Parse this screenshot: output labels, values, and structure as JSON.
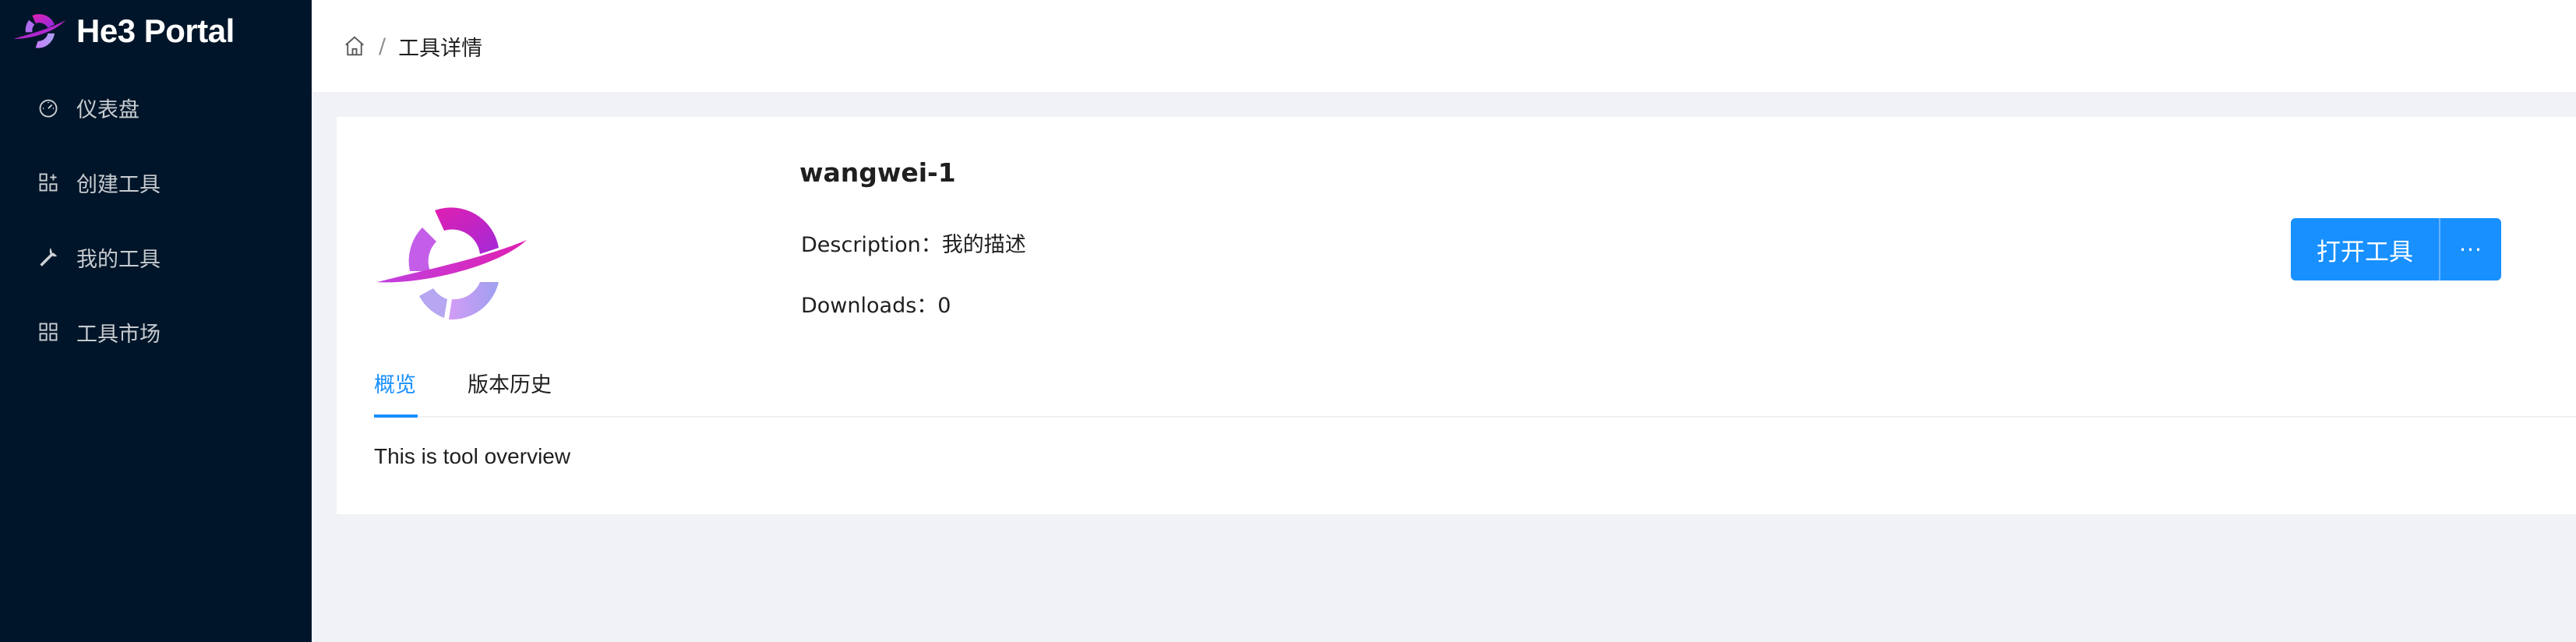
{
  "app": {
    "title": "He3 Portal"
  },
  "sidebar": {
    "items": [
      {
        "label": "仪表盘",
        "icon": "dashboard-icon"
      },
      {
        "label": "创建工具",
        "icon": "appstore-add-icon"
      },
      {
        "label": "我的工具",
        "icon": "wrench-icon"
      },
      {
        "label": "工具市场",
        "icon": "appstore-icon"
      }
    ]
  },
  "breadcrumb": {
    "home_icon": "home-icon",
    "separator": "/",
    "current": "工具详情"
  },
  "tool": {
    "name": "wangwei-1",
    "description_label": "Description：",
    "description_value": "我的描述",
    "downloads_label": "Downloads：",
    "downloads_value": "0"
  },
  "actions": {
    "open_label": "打开工具",
    "more_label": "···"
  },
  "tabs": [
    {
      "label": "概览",
      "active": true
    },
    {
      "label": "版本历史",
      "active": false
    }
  ],
  "overview": {
    "text": "This is tool overview"
  },
  "colors": {
    "sidebar_bg": "#001529",
    "primary": "#1890ff",
    "page_bg": "#f0f2f5",
    "logo_magenta": "#d41bb5",
    "logo_lavender": "#a9a0f0"
  }
}
